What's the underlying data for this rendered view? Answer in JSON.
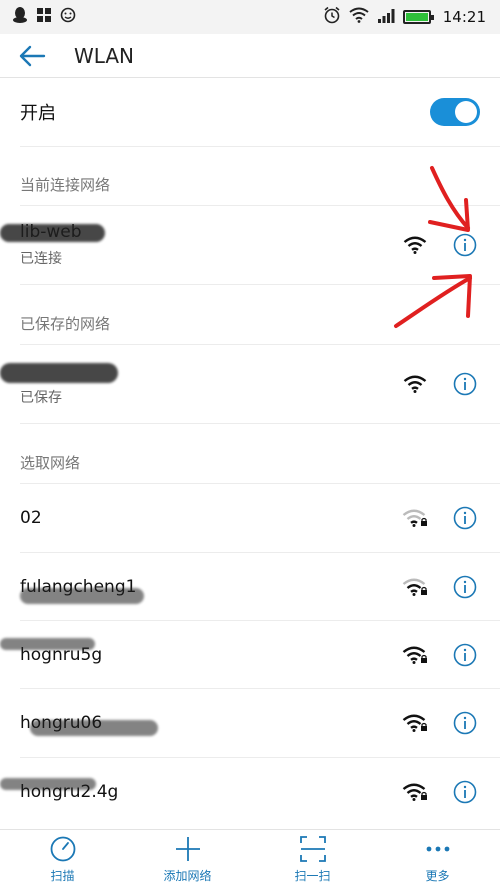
{
  "statusbar": {
    "time": "14:21"
  },
  "appbar": {
    "title": "WLAN"
  },
  "toggle": {
    "label": "开启",
    "on": true
  },
  "sections": {
    "current": "当前连接网络",
    "saved": "已保存的网络",
    "available": "选取网络"
  },
  "current_network": {
    "name": "lib-web",
    "status": "已连接"
  },
  "saved_network": {
    "name": "",
    "status": "已保存"
  },
  "available_networks": [
    {
      "name": "02"
    },
    {
      "name": "fulangcheng1"
    },
    {
      "name": "hognru5g"
    },
    {
      "name": "hongru06"
    },
    {
      "name": "hongru2.4g"
    }
  ],
  "bottombar": {
    "scan": "扫描",
    "add": "添加网络",
    "scan_qr": "扫一扫",
    "more": "更多"
  },
  "colors": {
    "accent": "#1b78b5",
    "toggle": "#1a8fd8",
    "annotation": "#e02020"
  }
}
